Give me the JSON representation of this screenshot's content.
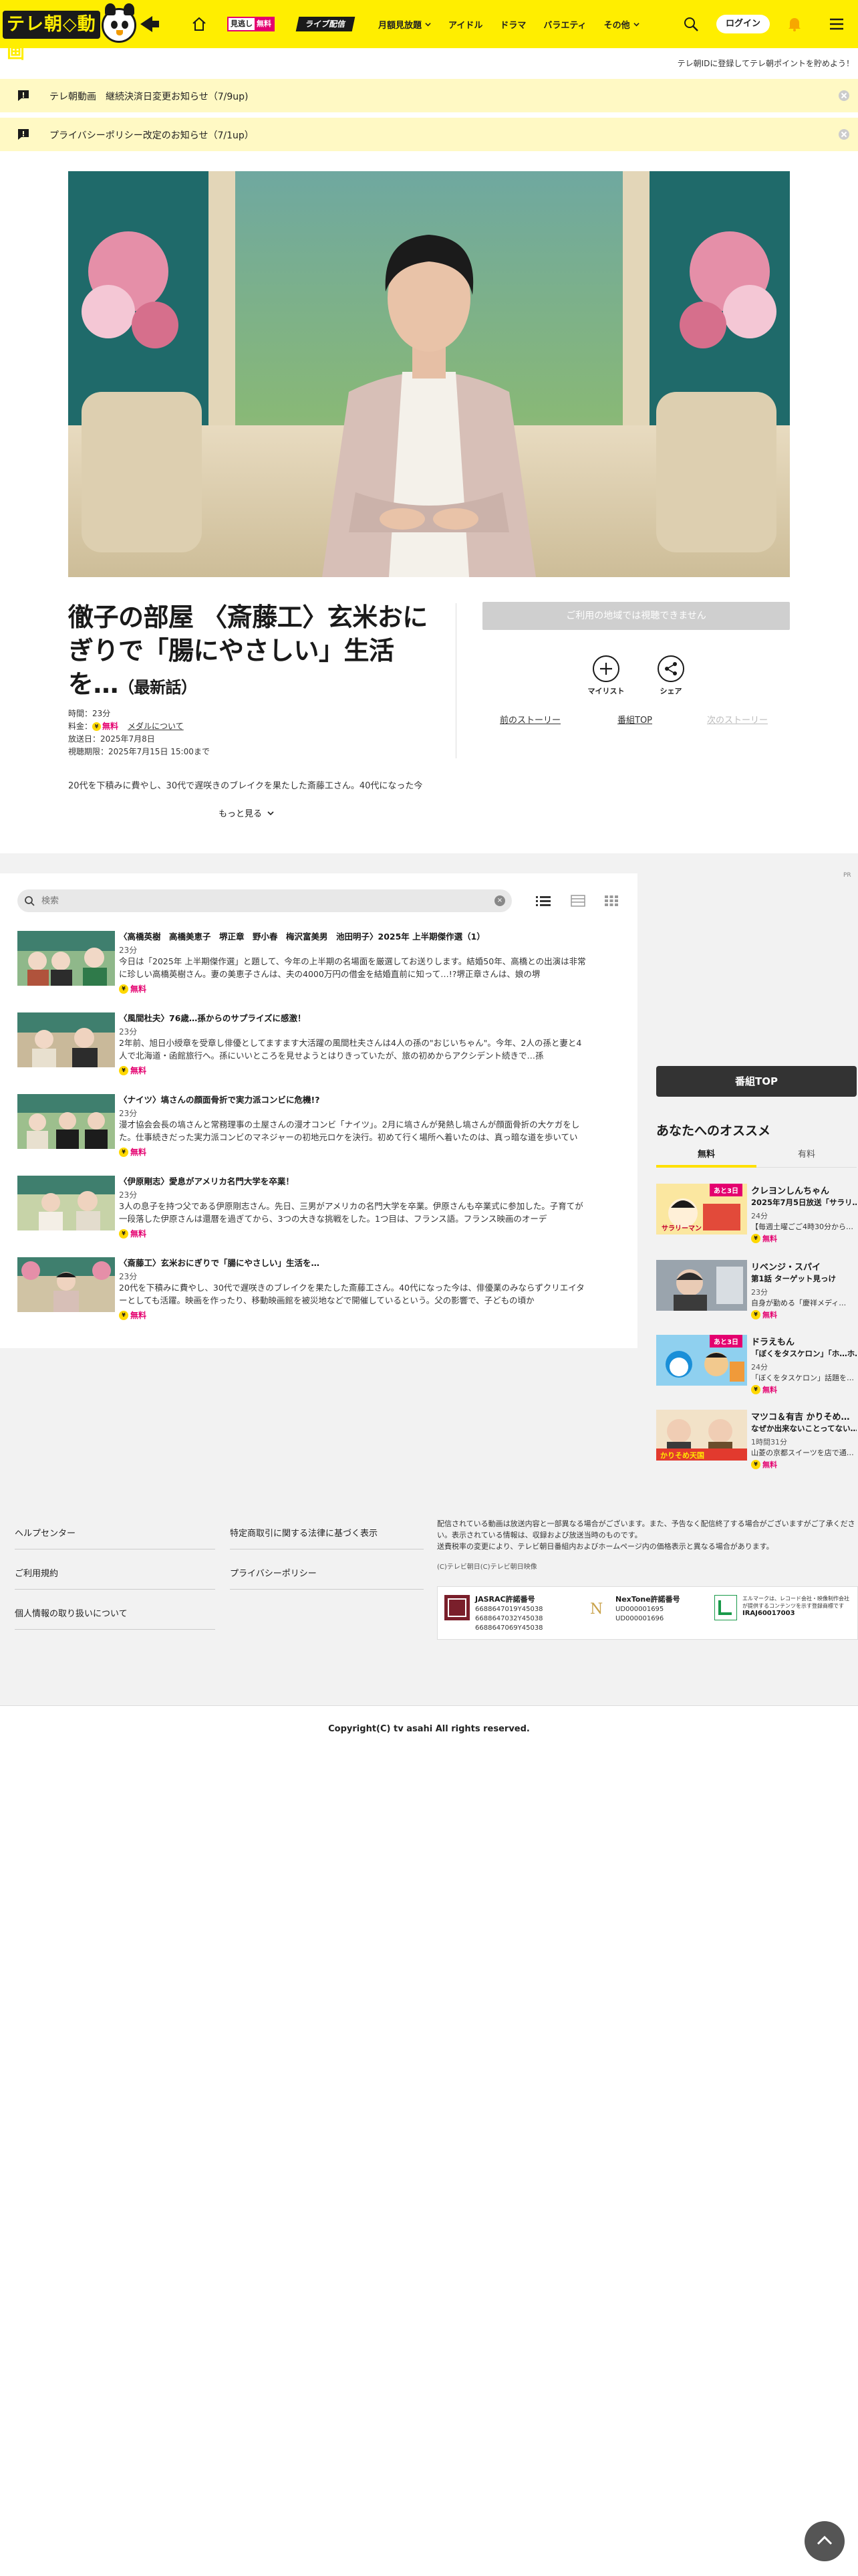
{
  "header": {
    "logo_text": "テレ朝◇動画",
    "mitogashi_label": "見逃し",
    "mitogashi_free": "無料",
    "live_label": "ライブ配信",
    "nav": [
      "月額見放題",
      "アイドル",
      "ドラマ",
      "バラエティ",
      "その他"
    ],
    "login_label": "ログイン",
    "promo": "テレ朝IDに登録してテレ朝ポイントを貯めよう！"
  },
  "notices": [
    {
      "text": "テレ朝動画　継続決済日変更お知らせ（7/9up)"
    },
    {
      "text": "プライバシーポリシー改定のお知らせ（7/1up）"
    }
  ],
  "episode": {
    "title": "徹子の部屋 〈斎藤工〉玄米おにぎりで「腸にやさしい」生活を…",
    "latest": "（最新話）",
    "duration": "時間：23分",
    "fee_label": "料金：",
    "fee_value": "無料",
    "fee_link": "メダルについて",
    "air_date": "放送日：2025年7月8日",
    "deadline": "視聴期限：2025年7月15日 15:00まで",
    "description": "20代を下積みに費やし、30代で遅咲きのブレイクを果たした斎藤工さん。40代になった今",
    "more_label": "もっと見る",
    "unavailable_label": "ご利用の地域では視聴できません",
    "mylist_label": "マイリスト",
    "share_label": "シェア",
    "prev_story": "前のストーリー",
    "program_top": "番組TOP",
    "next_story": "次のストーリー"
  },
  "episode_list": {
    "search_placeholder": "検索",
    "items": [
      {
        "title": "〈高橋英樹　高橋美恵子　堺正章　野小春　梅沢富美男　池田明子〉2025年 上半期傑作選（1）",
        "duration": "23分",
        "description": "今日は「2025年 上半期傑作選」と題して、今年の上半期の名場面を厳選してお送りします。結婚50年、高橋との出演は非常に珍しい高橋英樹さん。妻の美恵子さんは、夫の4000万円の借金を結婚直前に知って…!?堺正章さんは、娘の堺",
        "free": "無料"
      },
      {
        "title": "〈風間杜夫〉76歳…孫からのサプライズに感激！",
        "duration": "23分",
        "description": "2年前、旭日小綬章を受章し俳優としてますます大活躍の風間杜夫さんは4人の孫の\"おじいちゃん\"。今年、2人の孫と妻と4人で北海道・函館旅行へ。孫にいいところを見せようとはりきっていたが、旅の初めからアクシデント続きで…孫",
        "free": "無料"
      },
      {
        "title": "〈ナイツ〉塙さんの顔面骨折で実力派コンビに危機!?",
        "duration": "23分",
        "description": "漫才協会会長の塙さんと常務理事の土屋さんの漫才コンビ「ナイツ」。2月に塙さんが発熱し塙さんが顔面骨折の大ケガをした。仕事続きだった実力派コンビのマネジャーの初地元ロケを決行。初めて行く場所へ着いたのは、真っ暗な道を歩いてい",
        "free": "無料"
      },
      {
        "title": "〈伊原剛志〉愛息がアメリカ名門大学を卒業！",
        "duration": "23分",
        "description": "3人の息子を持つ父である伊原剛志さん。先日、三男がアメリカの名門大学を卒業。伊原さんも卒業式に参加した。子育てが一段落した伊原さんは還暦を過ぎてから、3つの大きな挑戦をした。1つ目は、フランス語。フランス映画のオーデ",
        "free": "無料"
      },
      {
        "title": "〈斎藤工〉玄米おにぎりで「腸にやさしい」生活を…",
        "duration": "23分",
        "description": "20代を下積みに費やし、30代で遅咲きのブレイクを果たした斎藤工さん。40代になった今は、俳優業のみならずクリエイターとしても活躍。映画を作ったり、移動映画館を被災地などで開催しているという。父の影響で、子どもの頃か",
        "free": "無料"
      }
    ]
  },
  "sidebar": {
    "program_top": "番組TOP",
    "reco_title": "あなたへのオススメ",
    "tabs": [
      "無料",
      "有料"
    ],
    "items": [
      {
        "title": "クレヨンしんちゃん",
        "subtitle": "2025年7月5日放送「サラリ…",
        "duration": "24分",
        "desc": "【毎週土曜ごご4時30分から…",
        "free": "無料",
        "tag": "あと3日"
      },
      {
        "title": "リベンジ・スパイ",
        "subtitle": "第1話 ターゲット見っけ",
        "duration": "23分",
        "desc": "自身が勤める「慶祥メディ…",
        "free": "無料",
        "tag": ""
      },
      {
        "title": "ドラえもん",
        "subtitle": "「ぼくをタスケロン」「ホ…ホ…",
        "duration": "24分",
        "desc": "「ぼくをタスケロン」話題を…",
        "free": "無料",
        "tag": "あと3日"
      },
      {
        "title": "マツコ＆有吉 かりそめ…",
        "subtitle": "なぜか出来ないことってない…",
        "duration": "1時間31分",
        "desc": "山菱の京都スイーツを店で通…",
        "free": "無料",
        "tag": ""
      }
    ]
  },
  "footer": {
    "links": [
      "ヘルプセンター",
      "ご利用規約",
      "個人情報の取り扱いについて",
      "特定商取引に関する法律に基づく表示",
      "プライバシーポリシー"
    ],
    "note": "配信されている動画は放送内容と一部異なる場合がございます。また、予告なく配信終了する場合がございますがご了承ください。表示されている情報は、収録および放送当時のものです。\n送費税率の変更により、テレビ朝日番組内およびホームページ内の価格表示と異なる場合があります。",
    "copy_small": "(C)テレビ朝日(C)テレビ朝日映像",
    "jasrac_title": "JASRAC許諾番号",
    "jasrac_nums": "6688647019Y45038\n6688647032Y45038\n6688647069Y45038",
    "nextone_title": "NexTone許諾番号",
    "nextone_nums": "UD000001695\nUD000001696",
    "lmark_text": "エルマークは、レコード会社・映像制作会社が提供するコンテンツを示す登録商標です",
    "lmark_num": "IRAJ60017003",
    "copyright": "Copyright(C) tv asahi All rights reserved."
  },
  "colors": {
    "brand_yellow": "#ffee00",
    "free_pink": "#e4006f",
    "notice_bg": "#fff9c4"
  }
}
